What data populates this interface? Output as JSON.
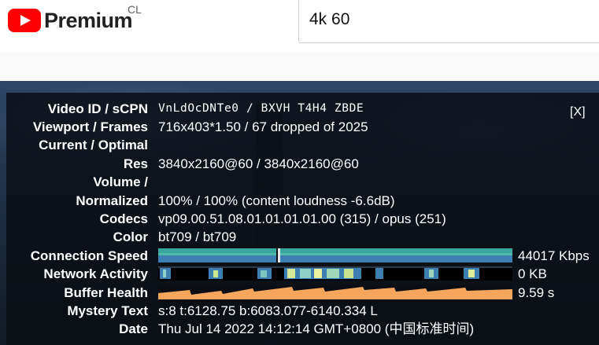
{
  "header": {
    "logo_text": "Premium",
    "country_code": "CL",
    "search_value": "4k 60",
    "youtube_red": "#ff0000"
  },
  "stats": {
    "close_label": "[X]",
    "rows": [
      {
        "label": "Video ID / sCPN",
        "value": "VnLdOcDNTe0 / BXVH T4H4 ZBDE"
      },
      {
        "label": "Viewport / Frames",
        "value": "716x403*1.50 / 67 dropped of 2025"
      },
      {
        "label": "Current / Optimal",
        "value": ""
      },
      {
        "label": "Res",
        "value": "3840x2160@60 / 3840x2160@60"
      },
      {
        "label": "Volume /",
        "value": ""
      },
      {
        "label": "Normalized",
        "value": "100% / 100% (content loudness -6.6dB)"
      },
      {
        "label": "Codecs",
        "value": "vp09.00.51.08.01.01.01.01.00 (315) / opus (251)"
      },
      {
        "label": "Color",
        "value": "bt709 / bt709"
      }
    ],
    "graphs": [
      {
        "label": "Connection Speed",
        "value": "44017 Kbps"
      },
      {
        "label": "Network Activity",
        "value": "0 KB"
      },
      {
        "label": "Buffer Health",
        "value": "9.59 s"
      }
    ],
    "tail_rows": [
      {
        "label": "Mystery Text",
        "value": "s:8 t:6128.75 b:6083.077-6140.334 L"
      },
      {
        "label": "Date",
        "value": "Thu Jul 14 2022 14:12:14 GMT+0800 (中国标准时间)"
      }
    ]
  },
  "colors": {
    "connection_teal": "#3aa6a0",
    "connection_blue": "#3d7fb0",
    "buffer_orange": "#f5a55c"
  }
}
